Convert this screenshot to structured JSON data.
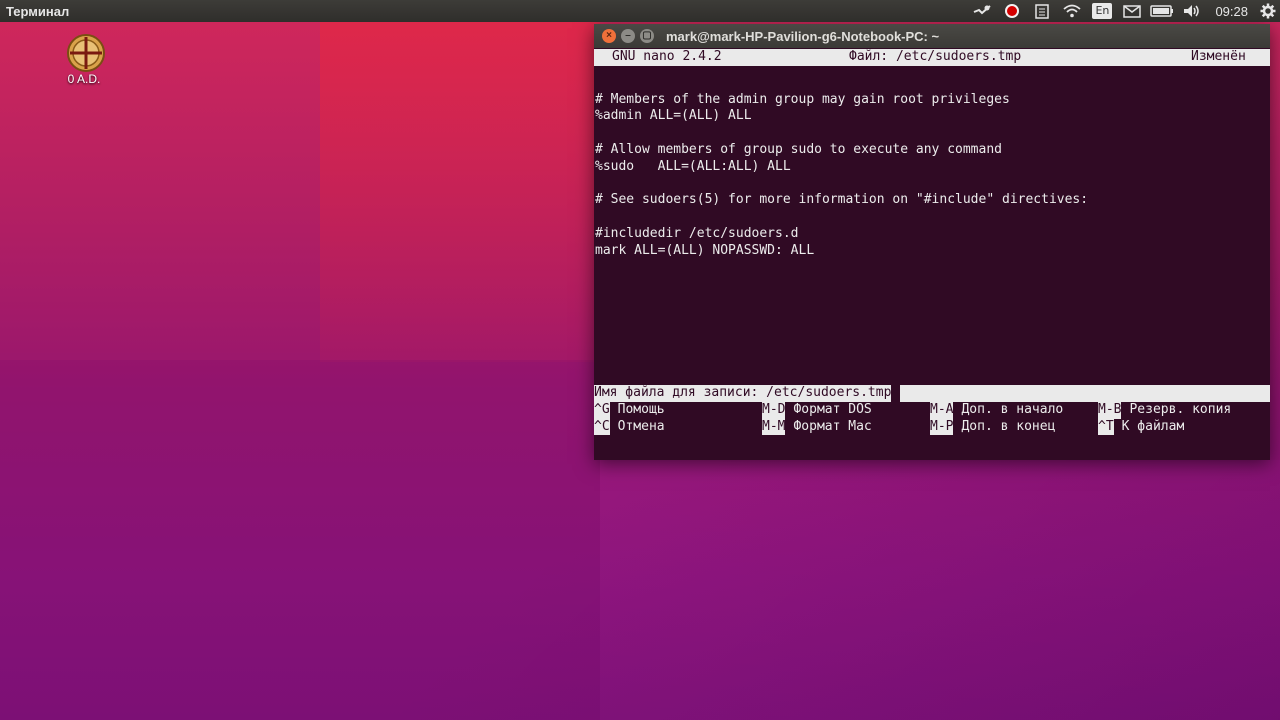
{
  "top_panel": {
    "app_title": "Терминал",
    "keyboard_layout": "En",
    "clock": "09:28",
    "indicator_icons": [
      "steam-icon",
      "record-icon",
      "clipboard-icon",
      "wifi-icon",
      "keyboard-layout-icon",
      "mail-icon",
      "battery-icon",
      "volume-icon",
      "gear-icon"
    ]
  },
  "desktop": {
    "icons": [
      {
        "label": "0 A.D.",
        "icon": "0ad-icon"
      }
    ]
  },
  "terminal_window": {
    "title": "mark@mark-HP-Pavilion-g6-Notebook-PC: ~",
    "nano": {
      "header_left": "GNU nano 2.4.2",
      "header_center": "Файл: /etc/sudoers.tmp",
      "header_right": "Изменён",
      "lines": [
        "",
        "# Members of the admin group may gain root privileges",
        "%admin ALL=(ALL) ALL",
        "",
        "# Allow members of group sudo to execute any command",
        "%sudo   ALL=(ALL:ALL) ALL",
        "",
        "# See sudoers(5) for more information on \"#include\" directives:",
        "",
        "#includedir /etc/sudoers.d",
        "mark ALL=(ALL) NOPASSWD: ALL"
      ],
      "prompt": "Имя файла для записи: /etc/sudoers.tmp",
      "shortcuts_row1": [
        {
          "key": "^G",
          "label": "Помощь"
        },
        {
          "key": "M-D",
          "label": "Формат DOS"
        },
        {
          "key": "M-A",
          "label": "Доп. в начало"
        },
        {
          "key": "M-B",
          "label": "Резерв. копия"
        }
      ],
      "shortcuts_row2": [
        {
          "key": "^C",
          "label": "Отмена"
        },
        {
          "key": "M-M",
          "label": "Формат Mac"
        },
        {
          "key": "M-P",
          "label": "Доп. в конец"
        },
        {
          "key": "^T",
          "label": "К файлам"
        }
      ]
    }
  }
}
